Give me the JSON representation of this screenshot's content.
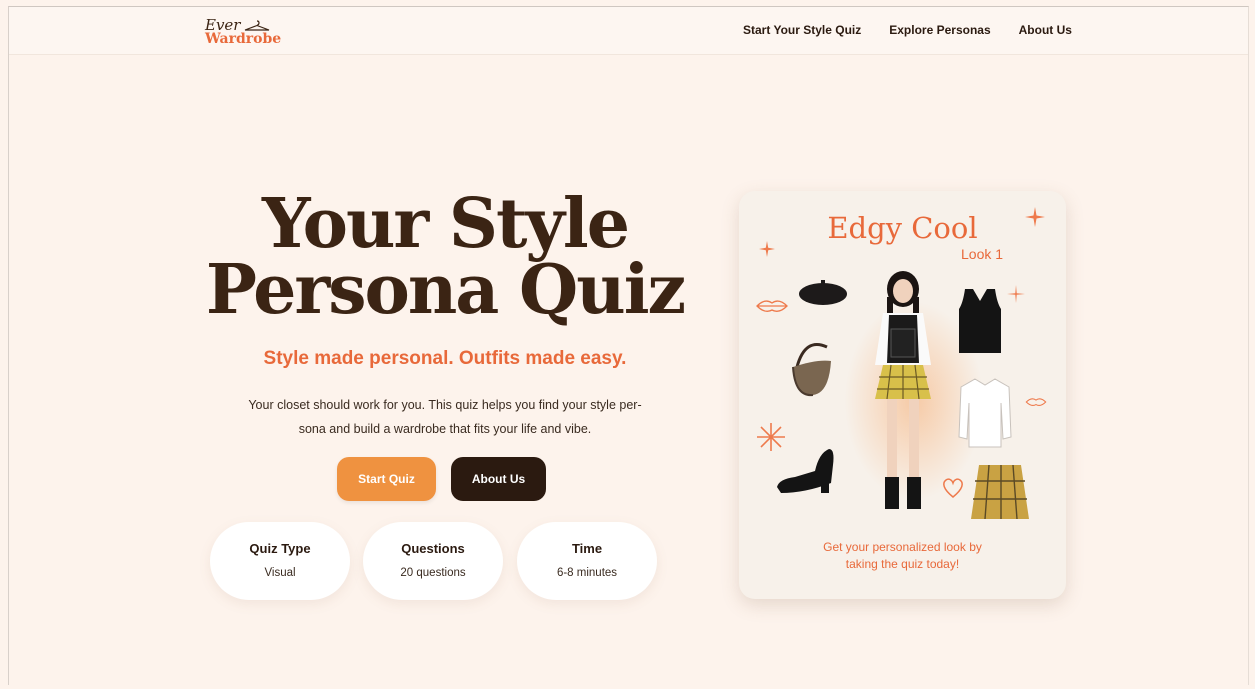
{
  "brand": {
    "line1": "Ever",
    "line2": "Wardrobe"
  },
  "nav": {
    "items": [
      {
        "label": "Start Your Style Quiz"
      },
      {
        "label": "Explore Personas"
      },
      {
        "label": "About Us"
      }
    ]
  },
  "hero": {
    "title_line1": "Your Style",
    "title_line2": "Persona Quiz",
    "tagline": "Style made personal. Outfits made easy.",
    "intro_line1": "Your closet should work for you. This quiz helps you find your style per-",
    "intro_line2": "sona and build a wardrobe that fits your life and vibe.",
    "start_button": "Start Quiz",
    "about_button": "About Us"
  },
  "stats": [
    {
      "title": "Quiz Type",
      "value": "Visual"
    },
    {
      "title": "Questions",
      "value": "20 questions"
    },
    {
      "title": "Time",
      "value": "6-8 minutes"
    }
  ],
  "card": {
    "title": "Edgy Cool",
    "subtitle": "Look 1",
    "footer_line1": "Get your personalized look by",
    "footer_line2": "taking the quiz today!"
  },
  "colors": {
    "background": "#fdf3ec",
    "accent": "#e8693a",
    "primary_button": "#ef9240",
    "dark": "#2b1a10"
  }
}
